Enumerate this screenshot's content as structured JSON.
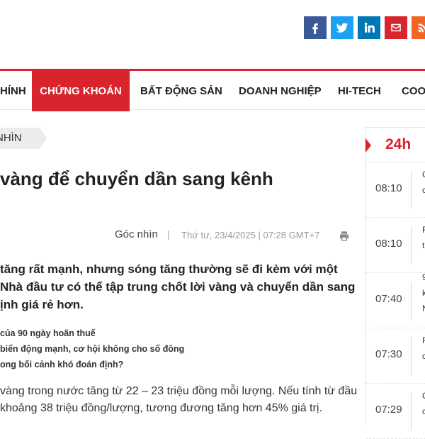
{
  "social": {
    "icons": [
      "facebook-icon",
      "twitter-icon",
      "linkedin-icon",
      "mail-icon",
      "rss-icon"
    ]
  },
  "nav": {
    "items": [
      {
        "label": "HÍNH"
      },
      {
        "label": "CHỨNG KHOÁN"
      },
      {
        "label": "BẤT ĐỘNG SẢN"
      },
      {
        "label": "DOANH NGHIỆP"
      },
      {
        "label": "HI-TECH"
      },
      {
        "label": "COO"
      }
    ],
    "active_index": 1
  },
  "breadcrumb": {
    "label": "NHÌN"
  },
  "article": {
    "title": "vàng để chuyển dần sang kênh",
    "category": "Góc nhìn",
    "separator": "|",
    "date": "Thứ tư, 23/4/2025 | 07:28 GMT+7",
    "sapo_lines": [
      "tăng rất mạnh, nhưng sóng tăng thường sẽ đi kèm với một",
      "Nhà đầu tư có thể tập trung chốt lời vàng và chuyển dần sang",
      "ịnh giá rẻ hơn."
    ],
    "related": [
      "của 90 ngày hoãn thuế",
      "biến động mạnh, cơ hội không cho số đông",
      "ong bối cảnh khó đoán định?"
    ],
    "body_lines": [
      "vàng trong nước tăng từ 22 – 23 triệu đồng mỗi lượng. Nếu tính từ đầu",
      "khoảng 38 triệu đồng/lượng, tương đương tăng hơn 45% giá trị."
    ]
  },
  "sidebar": {
    "heading": "24h",
    "items": [
      {
        "time": "08:10",
        "snippet": [
          "C",
          "c"
        ]
      },
      {
        "time": "08:10",
        "snippet": [
          "F",
          "t"
        ]
      },
      {
        "time": "07:40",
        "snippet": [
          "9",
          "k",
          "N"
        ]
      },
      {
        "time": "07:30",
        "snippet": [
          "F",
          "c"
        ]
      },
      {
        "time": "07:29",
        "snippet": [
          "C",
          "c"
        ]
      }
    ]
  },
  "colors": {
    "accent": "#d9232d",
    "facebook": "#3b5998",
    "twitter": "#1da1f2",
    "linkedin": "#0077b5",
    "rss": "#f26522"
  }
}
